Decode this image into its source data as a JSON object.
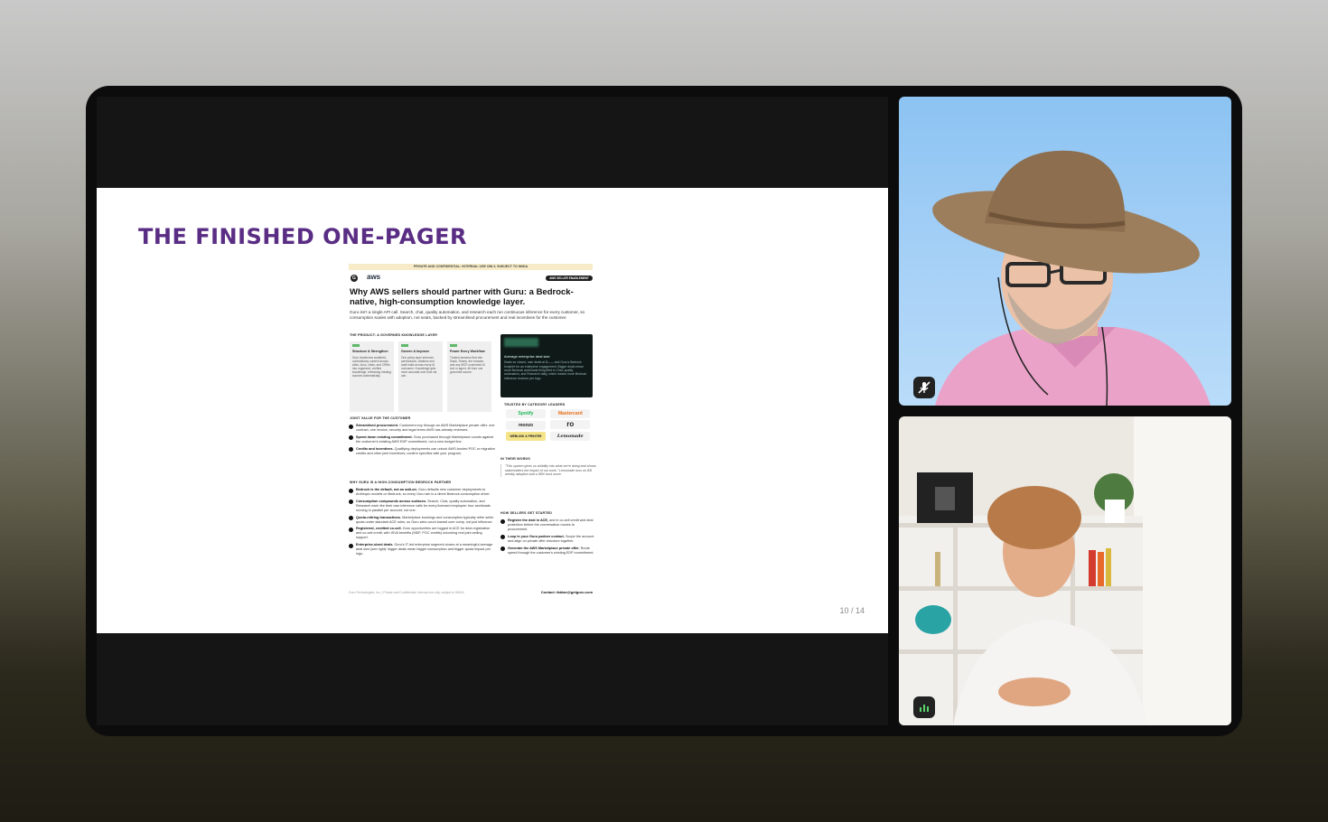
{
  "slide": {
    "title": "THE FINISHED ONE-PAGER",
    "page_indicator": "10 / 14"
  },
  "one_pager": {
    "banner": "PRIVATE AND CONFIDENTIAL: INTERNAL USE ONLY, SUBJECT TO NNDA",
    "aws_logo": "aws",
    "pill": "AWS SELLER ENABLEMENT",
    "headline": "Why AWS sellers should partner with Guru: a Bedrock-native, high-consumption knowledge layer.",
    "intro": "Guru isn't a single API call. Search, chat, quality automation, and research each run continuous inference for every customer, so consumption scales with adoption, not seats, backed by streamlined procurement and real incentives for the customer.",
    "product_heading": "THE PRODUCT: A GOVERNED KNOWLEDGE LAYER",
    "cards": [
      {
        "title": "Structure & Strengthen",
        "body": "Guru transforms scattered, contradictory content across wikis, docs, chats, and CRMs into organized, verified knowledge, refreshing existing sources automatically."
      },
      {
        "title": "Govern & Improve",
        "body": "One policy layer enforces permissions, citations and audit trails across every AI consumer. Knowledge gets more accurate over time via use."
      },
      {
        "title": "Power Every Workflow",
        "body": "Trusted answers flow into Slack, Teams, the browser, and any MCP-connected AI tool or agent. All from one governed source."
      }
    ],
    "stat_card": {
      "title": "Average enterprise deal size",
      "body": "Deals so closed, user deals at $—— and Guru's Bedrock footprint for an enterprise engagement. Bigger deals mean more Bedrock workloads firing fleet in Chat, quality automation, and Research daily, which means more Bedrock inference revenue per logo."
    },
    "trusted_heading": "TRUSTED BY CATEGORY LEADERS",
    "logos": [
      "Spotify",
      "Mastercard",
      "monzo",
      "ro",
      "WEBLINK & PRINTER",
      "Lemonade"
    ],
    "joint_value_heading": "JOINT VALUE FOR THE CUSTOMER",
    "joint_value": [
      {
        "bold": "Streamlined procurement.",
        "text": "Customers buy through an AWS Marketplace private offer: one contract, one invoice, security and legal terms AWS has already reviewed."
      },
      {
        "bold": "Spend down existing commitment.",
        "text": "Guru purchased through Marketplace counts against the customer's existing AWS EDP commitment, not a new budget line."
      },
      {
        "bold": "Credits and incentives.",
        "text": "Qualifying deployments can unlock AWS-funded POC or migration credits and other joint incentives; confirm specifics with your program."
      }
    ],
    "why_heading": "WHY GURU IS A HIGH-CONSUMPTION BEDROCK PARTNER",
    "why": [
      {
        "bold": "Bedrock is the default, not an add-on.",
        "text": "Guru defaults new customer deployments to Anthropic models on Bedrock, so every Guru win is a direct Bedrock consumption driver."
      },
      {
        "bold": "Consumption compounds across surfaces.",
        "text": "Search, Chat, quality automation, and Research each fire their own inference calls for every licensed employee: four workloads running in parallel per account, not one."
      },
      {
        "bold": "Quota-retiring transactions.",
        "text": "Marketplace bookings and consumption typically retire seller quota under standard ACE rules, so Guru wins count toward core comp, not just influence."
      },
      {
        "bold": "Registered, credited co-sell.",
        "text": "Guru opportunities are logged in ACE for deal registration and co-sell credit, with ISVA benefits (MDF, POC credits) unlocking real joint-selling support."
      },
      {
        "bold": "Enterprise-sized deals.",
        "text": "Guru's IT-led enterprise segment closes at a meaningful average deal size (see right): bigger deals mean bigger consumption and bigger quota impact per logo."
      }
    ],
    "words_heading": "IN THEIR WORDS",
    "quote": "\"This system gives us visibility into what we're doing and shows stakeholders the impact of our work.\" Lemonade runs on 8/8 weekly adoption and a 98% trust score.",
    "get_started_heading": "HOW SELLERS GET STARTED",
    "get_started": [
      {
        "bold": "Register the deal in ACE,",
        "text": "and in co-sell credit and deal protection before the conversation moves to procurement."
      },
      {
        "bold": "Loop in your Guru partner contact.",
        "text": "Scope the account and align on private offer structure together."
      },
      {
        "bold": "Generate the AWS Marketplace private offer.",
        "text": "Route spend through the customer's existing EDP commitment."
      }
    ],
    "footer": "Guru Technologies, Inc. | Private and Confidential: internal use only, subject to NNDA",
    "contact": "Contact: fabian@getguru.com"
  },
  "participants": {
    "top": {
      "mic_icon": "mic-off-icon"
    },
    "bottom": {
      "mic_icon": "mic-on-icon"
    }
  }
}
